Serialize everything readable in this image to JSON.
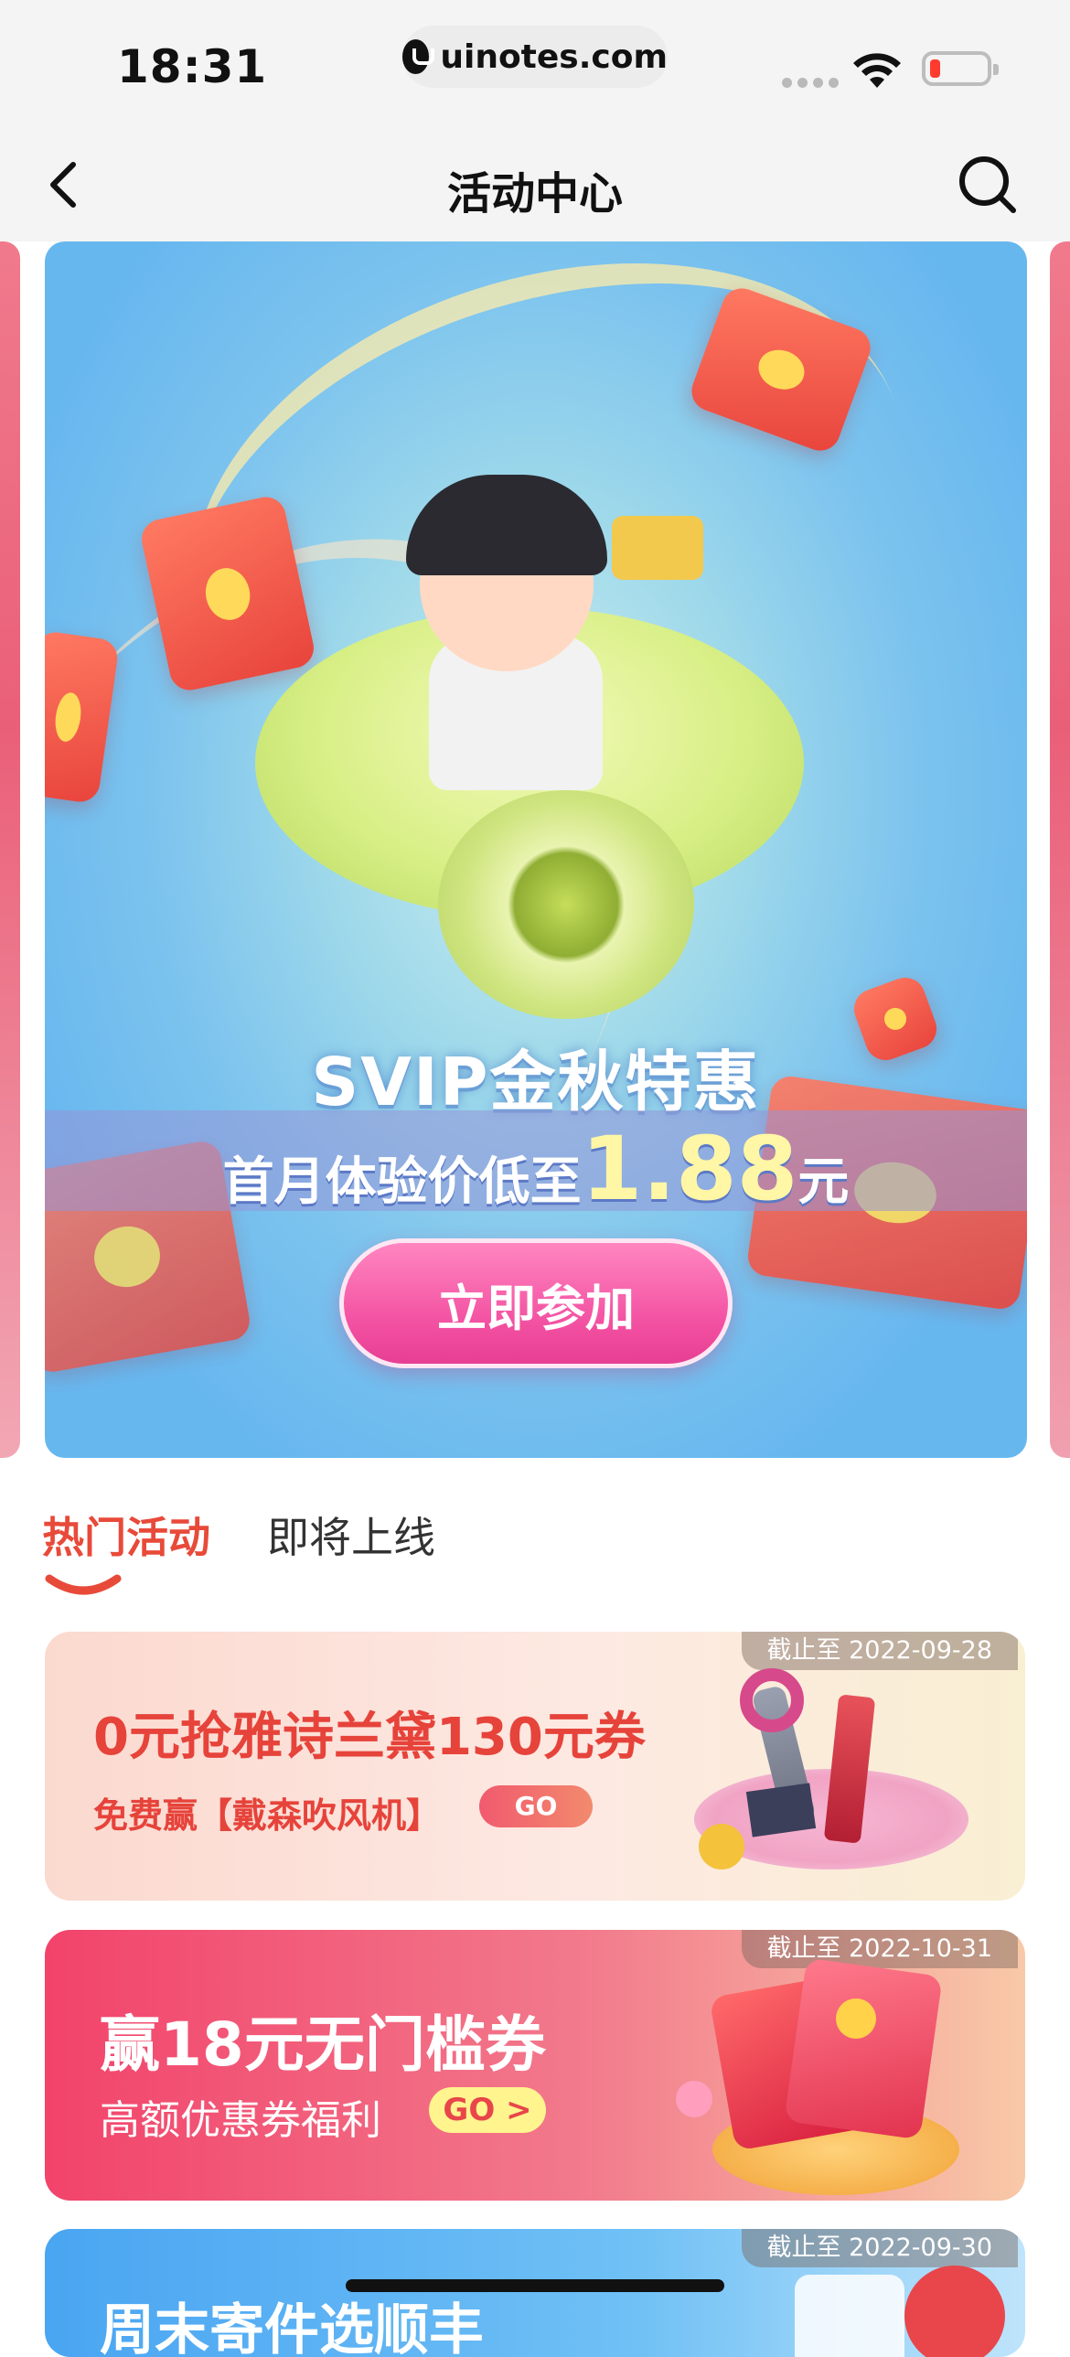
{
  "status_bar": {
    "time": "18:31",
    "url": "uinotes.com",
    "icons": [
      "cellular-signal-icon",
      "wifi-icon",
      "battery-low-icon"
    ]
  },
  "nav": {
    "title": "活动中心",
    "back_icon": "chevron-left-icon",
    "search_icon": "search-icon"
  },
  "banner": {
    "headline": "SVIP金秋特惠",
    "subline_prefix": "首月体验价低至",
    "price": "1.88",
    "price_unit": "元",
    "button_label": "立即参加"
  },
  "tabs": [
    {
      "label": "热门活动",
      "active": true
    },
    {
      "label": "即将上线",
      "active": false
    }
  ],
  "activities": [
    {
      "deadline": "截止至 2022-09-28",
      "title": "0元抢雅诗兰黛130元券",
      "subtitle": "免费赢【戴森吹风机】",
      "go_label": "GO"
    },
    {
      "deadline": "截止至 2022-10-31",
      "title": "赢18元无门槛券",
      "subtitle": "高额优惠券福利",
      "go_label": "GO >"
    },
    {
      "deadline": "截止至 2022-09-30",
      "title": "周末寄件选顺丰"
    }
  ],
  "colors": {
    "accent_red": "#e84a3a",
    "button_pink": "#f24ea0",
    "status_bg": "#f4f4f4"
  }
}
